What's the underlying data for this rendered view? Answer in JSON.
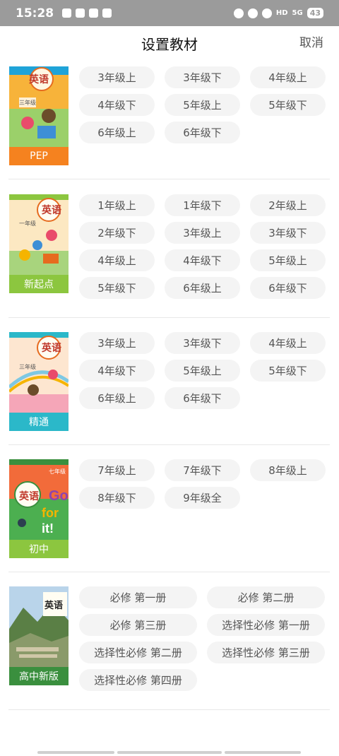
{
  "status_bar": {
    "time": "15:28",
    "network_label": "HD",
    "signal_label": "5G",
    "battery": "43"
  },
  "header": {
    "title": "设置教材",
    "cancel_label": "取消"
  },
  "sections": [
    {
      "band_label": "PEP",
      "band_color": "#f5821f",
      "cover_title": "英语",
      "grade_label": "三年级",
      "grades": [
        "3年级上",
        "3年级下",
        "4年级上",
        "4年级下",
        "5年级上",
        "5年级下",
        "6年级上",
        "6年级下"
      ]
    },
    {
      "band_label": "新起点",
      "band_color": "#8cc63f",
      "cover_title": "英语",
      "grade_label": "一年级",
      "grades": [
        "1年级上",
        "1年级下",
        "2年级上",
        "2年级下",
        "3年级上",
        "3年级下",
        "4年级上",
        "4年级下",
        "5年级上",
        "5年级下",
        "6年级上",
        "6年级下"
      ]
    },
    {
      "band_label": "精通",
      "band_color": "#2bb8c9",
      "cover_title": "英语",
      "grade_label": "三年级",
      "grades": [
        "3年级上",
        "3年级下",
        "4年级上",
        "4年级下",
        "5年级上",
        "5年级下",
        "6年级上",
        "6年级下"
      ]
    },
    {
      "band_label": "初中",
      "band_color": "#8cc63f",
      "cover_title": "英语",
      "grade_label": "七年级",
      "grades": [
        "7年级上",
        "7年级下",
        "8年级上",
        "8年级下",
        "9年级全"
      ]
    },
    {
      "band_label": "高中新版",
      "band_color": "#3a8f3e",
      "cover_title": "英语",
      "grades": [
        "必修 第一册",
        "必修 第二册",
        "必修 第三册",
        "选择性必修 第一册",
        "选择性必修 第二册",
        "选择性必修 第三册",
        "选择性必修 第四册"
      ]
    }
  ]
}
